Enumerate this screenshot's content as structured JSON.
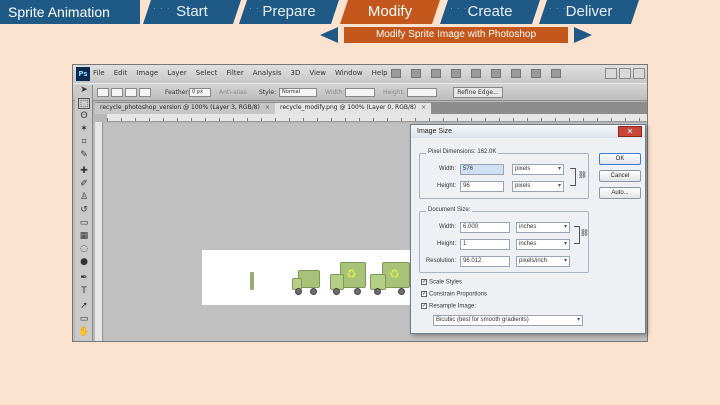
{
  "nav": {
    "title": "Sprite Animation",
    "tabs": [
      {
        "label": "Start"
      },
      {
        "label": "Prepare"
      },
      {
        "label": "Modify"
      },
      {
        "label": "Create"
      },
      {
        "label": "Deliver"
      }
    ],
    "subtitle": "Modify Sprite Image with Photoshop",
    "colors": {
      "blue": "#1f5a86",
      "orange": "#c4571b",
      "background": "#fbe3cf"
    }
  },
  "photoshop": {
    "logo": "Ps",
    "menu": [
      "File",
      "Edit",
      "Image",
      "Layer",
      "Select",
      "Filter",
      "Analysis",
      "3D",
      "View",
      "Window",
      "Help"
    ],
    "options": {
      "feather_label": "Feather:",
      "feather_value": "0 px",
      "antialias_label": "Anti-alias",
      "style_label": "Style:",
      "style_value": "Normal",
      "width_label": "Width:",
      "height_label": "Height:",
      "refine_button": "Refine Edge..."
    },
    "doc_tabs": [
      {
        "label": "recycle_photoshop_version @ 100% (Layer 3, RGB/8)",
        "close": "×"
      },
      {
        "label": "recycle_modify.png @ 100% (Layer 0, RGB/8)",
        "close": "×"
      }
    ],
    "tools": [
      "move-icon",
      "marquee-icon",
      "lasso-icon",
      "magic-wand-icon",
      "crop-icon",
      "eyedropper-icon",
      "healing-icon",
      "brush-icon",
      "stamp-icon",
      "history-brush-icon",
      "eraser-icon",
      "gradient-icon",
      "blur-icon",
      "dodge-icon",
      "pen-icon",
      "type-icon"
    ],
    "tool_glyphs": [
      "➤",
      "⬚",
      "ʘ",
      "✶",
      "⌗",
      "✎",
      "✚",
      "✐",
      "♙",
      "↺",
      "▭",
      "▦",
      "◌",
      "●",
      "✒",
      "T"
    ]
  },
  "image_size_dialog": {
    "title": "Image Size",
    "close": "✕",
    "pixel_dimensions": {
      "legend": "Pixel Dimensions: 162.0K",
      "width_label": "Width:",
      "width_value": "576",
      "width_unit": "pixels",
      "height_label": "Height:",
      "height_value": "96",
      "height_unit": "pixels"
    },
    "document_size": {
      "legend": "Document Size:",
      "width_label": "Width:",
      "width_value": "6.000",
      "width_unit": "inches",
      "height_label": "Height:",
      "height_value": "1",
      "height_unit": "inches",
      "resolution_label": "Resolution:",
      "resolution_value": "96.012",
      "resolution_unit": "pixels/inch"
    },
    "buttons": {
      "ok": "OK",
      "cancel": "Cancel",
      "auto": "Auto..."
    },
    "checkboxes": {
      "scale_styles": "Scale Styles",
      "constrain": "Constrain Proportions",
      "resample": "Resample Image:"
    },
    "resample_method": "Bicubic (best for smooth gradients)"
  }
}
